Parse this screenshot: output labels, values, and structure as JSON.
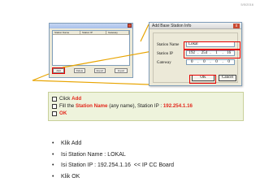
{
  "page_number": "5/5/2016",
  "base_station_window": {
    "columns": [
      "Station Name",
      "Station IP",
      "Gateway"
    ],
    "buttons": [
      "Add",
      "Delete",
      "Export",
      "Import"
    ]
  },
  "dialog": {
    "title": "Add Base Station Info",
    "close": "x",
    "station_name_label": "Station Name",
    "station_name_value": "Lokal",
    "station_ip_label": "Station IP",
    "station_ip_octets": [
      "192",
      "254",
      "1",
      "16"
    ],
    "gateway_label": "Gateway",
    "gateway_octets": [
      "0",
      "0",
      "0",
      "0"
    ],
    "ok_label": "OK",
    "cancel_label": "Cancel",
    "dot": "."
  },
  "instructions": {
    "line1_prefix": "Click ",
    "line1_highlight": "Add",
    "line2_prefix": "Fill the ",
    "line2_highlight1": "Station Name",
    "line2_mid": " (any name), Station IP : ",
    "line2_highlight2": "192.254.1.16",
    "line3_highlight": "OK"
  },
  "bullets": [
    "Klik Add",
    "Isi Station Name : LOKAL",
    "Isi Station IP : 192.254.1.16  << IP CC Board",
    "Klik OK"
  ],
  "bullet_symbol": "•",
  "colors": {
    "highlight_red": "#e3271b",
    "instruction_bg": "#eef3dc"
  }
}
